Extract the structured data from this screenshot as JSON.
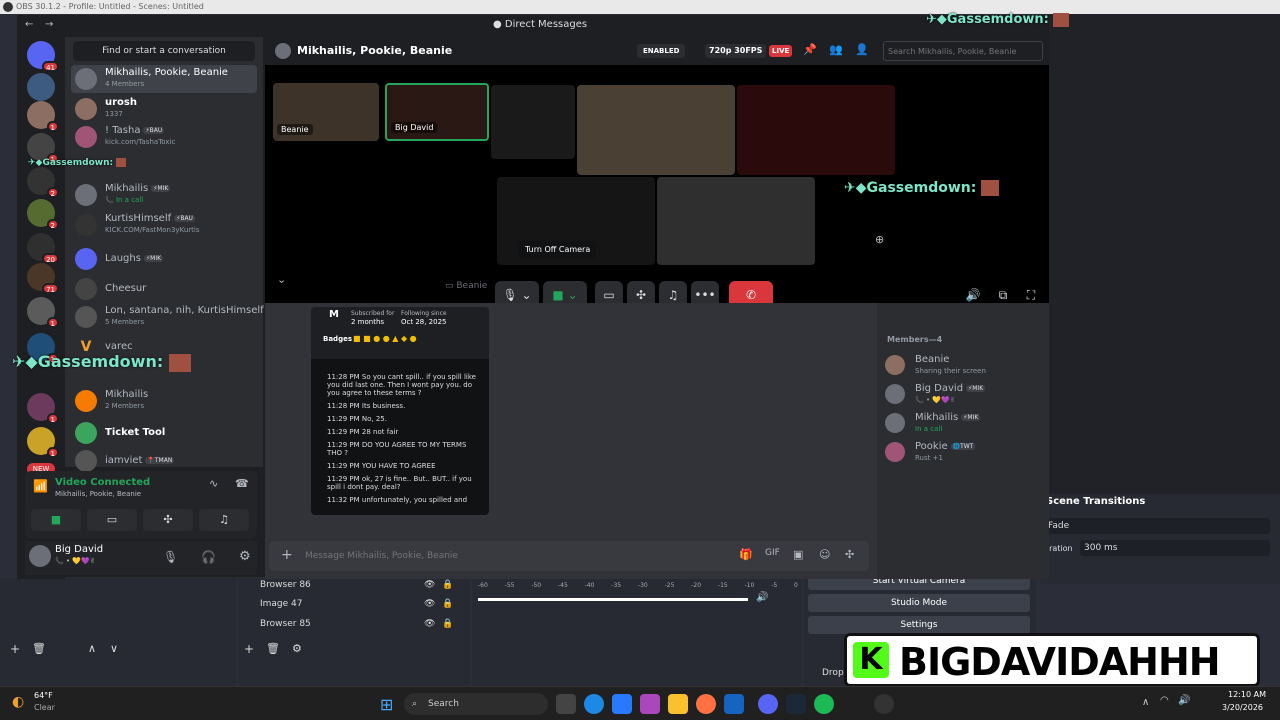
{
  "obs": {
    "title": "OBS 30.1.2 - Profile: Untitled - Scenes: Untitled",
    "sources": [
      {
        "name": "Browser 86",
        "icon": "globe-icon"
      },
      {
        "name": "Image 47",
        "icon": "image-icon"
      },
      {
        "name": "Browser 85",
        "icon": "globe-icon"
      }
    ],
    "controls": {
      "virtual_camera": "Start Virtual Camera",
      "studio_mode": "Studio Mode",
      "settings": "Settings",
      "drop": "Drop"
    },
    "transitions": {
      "title": "Scene Transitions",
      "type": "Fade",
      "duration_label": "uration",
      "duration": "300 ms"
    },
    "audio_ticks": [
      "-60",
      "-55",
      "-50",
      "-45",
      "-40",
      "-35",
      "-30",
      "-25",
      "-20",
      "-15",
      "-10",
      "-5",
      "0"
    ]
  },
  "discord": {
    "window_title": "Direct Messages",
    "find_placeholder": "Find or start a conversation",
    "guild_badges": [
      "41",
      "",
      "1",
      "1",
      "2",
      "2",
      "20",
      "71",
      "1",
      "1",
      "1",
      "1"
    ],
    "new_badge": "NEW",
    "dms": [
      {
        "name": "Mikhailis, Pookie, Beanie",
        "sub": "4 Members",
        "active": true
      },
      {
        "name": "urosh",
        "sub": "1337",
        "bold": true
      },
      {
        "name": "! Tasha",
        "tag": "⚡BAU",
        "sub": "kick.com/TashaToxic"
      },
      {
        "name": "",
        "sub": ""
      },
      {
        "name": "Mikhailis",
        "tag": "⚡MIK",
        "sub": "In a call"
      },
      {
        "name": "KurtisHimself",
        "tag": "⚡BAU",
        "sub": "KICK.COM/FastMon3yKurtis"
      },
      {
        "name": "Laughs",
        "tag": "⚡MIK",
        "sub": ""
      },
      {
        "name": "Cheesur",
        "sub": ""
      },
      {
        "name": "Lon, santana, nih, KurtisHimself",
        "sub": "5 Members"
      },
      {
        "name": "varec",
        "sub": ""
      },
      {
        "name": "",
        "sub": ""
      },
      {
        "name": "Mikhailis",
        "sub": "2 Members"
      },
      {
        "name": "Ticket Tool",
        "sub": "",
        "bold": true
      },
      {
        "name": "iamviet",
        "tag": "📍TMAN",
        "sub": ""
      }
    ],
    "voice": {
      "status": "Video Connected",
      "channel": "Mikhailis, Pookie, Beanie"
    },
    "user": {
      "name": "Big David",
      "status": "📞 • 💛💜✌"
    },
    "chat_header": {
      "title": "Mikhailis, Pookie, Beanie",
      "enabled_badge": "ENABLED",
      "quality": "720p 30FPS",
      "live": "LIVE",
      "search_placeholder": "Search Mikhailis, Pookie, Beanie"
    },
    "tiles": [
      {
        "label": "Beanie"
      },
      {
        "label": "Big David"
      },
      {
        "label": ""
      },
      {
        "label": ""
      },
      {
        "label": ""
      },
      {
        "label": ""
      },
      {
        "label": ""
      }
    ],
    "tooltip": "Turn Off Camera",
    "stream_label": "Beanie",
    "popout": {
      "subscribed_label": "Subscribed for",
      "subscribed_value": "2 months",
      "following_label": "Following since",
      "following_value": "Oct 28, 2025",
      "badges_label": "Badges",
      "messages": [
        "11:28 PM So you cant spill.. if you spill like you did last one. Then I wont pay you. do you agree to these terms ?",
        "11:28 PM Its business.",
        "11:29 PM No, 25.",
        "11:29 PM 28 not fair",
        "11:29 PM DO YOU AGREE TO MY TERMS THO ?",
        "11:29 PM YOU HAVE TO AGREE",
        "11:29 PM ok, 27 is fine.. But.. BUT.. if you spill i dont pay. deal?",
        "11:32 PM unfortunately, you spilled and"
      ]
    },
    "members_header": "Members—4",
    "members": [
      {
        "name": "Beanie",
        "sub": "Sharing their screen"
      },
      {
        "name": "Big David",
        "tag": "⚡MIK",
        "sub": "📞 • 💛💜✌"
      },
      {
        "name": "Mikhailis",
        "tag": "⚡MIK",
        "sub": "In a call"
      },
      {
        "name": "Pookie",
        "tag": "🌐TWT",
        "sub": "Rust +1"
      }
    ],
    "message_placeholder": "Message Mikhailis, Pookie, Beanie"
  },
  "overlays": {
    "gassem_name": "Gassemdown:",
    "banner": "BIGDAVIDAHHH",
    "banner_k": "K"
  },
  "taskbar": {
    "weather_temp": "64°F",
    "weather_desc": "Clear",
    "search": "Search",
    "time": "12:10 AM",
    "date": "3/20/2026"
  }
}
